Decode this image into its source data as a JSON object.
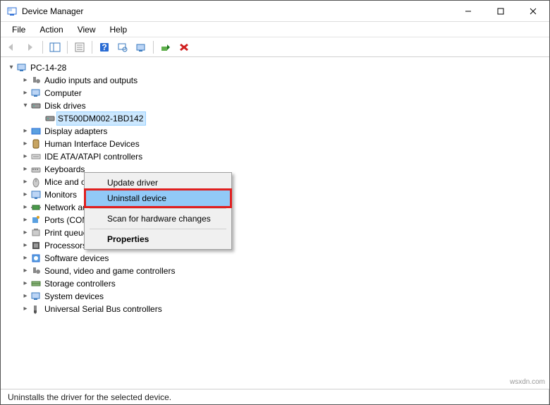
{
  "window": {
    "title": "Device Manager"
  },
  "win_controls": {
    "min": "–",
    "max": "☐",
    "close": "✕"
  },
  "menu": {
    "file": "File",
    "action": "Action",
    "view": "View",
    "help": "Help"
  },
  "tree": {
    "root": "PC-14-28",
    "items": [
      {
        "label": "Audio inputs and outputs"
      },
      {
        "label": "Computer"
      },
      {
        "label": "Disk drives",
        "expanded": true,
        "child": "ST500DM002-1BD142"
      },
      {
        "label": "Display adapters"
      },
      {
        "label": "Human Interface Devices"
      },
      {
        "label": "IDE ATA/ATAPI controllers"
      },
      {
        "label": "Keyboards"
      },
      {
        "label": "Mice and other pointing devices"
      },
      {
        "label": "Monitors"
      },
      {
        "label": "Network adapters"
      },
      {
        "label": "Ports (COM & LPT)"
      },
      {
        "label": "Print queues"
      },
      {
        "label": "Processors"
      },
      {
        "label": "Software devices"
      },
      {
        "label": "Sound, video and game controllers"
      },
      {
        "label": "Storage controllers"
      },
      {
        "label": "System devices"
      },
      {
        "label": "Universal Serial Bus controllers"
      }
    ]
  },
  "context_menu": {
    "update": "Update driver",
    "uninstall": "Uninstall device",
    "scan": "Scan for hardware changes",
    "properties": "Properties"
  },
  "status": {
    "text": "Uninstalls the driver for the selected device."
  },
  "watermark": "wsxdn.com"
}
